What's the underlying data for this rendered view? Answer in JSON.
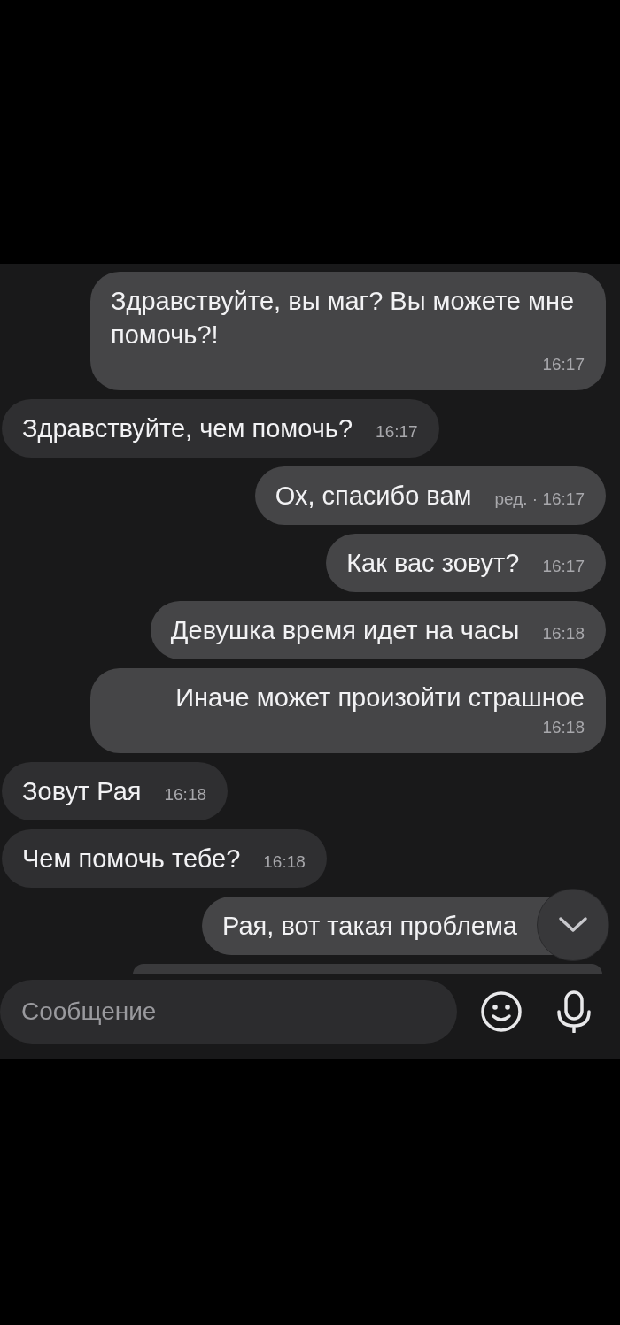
{
  "messages": [
    {
      "kind": "outgoing",
      "text": "Здравствуйте, вы маг? Вы можете мне помочь?!",
      "time": "16:17"
    },
    {
      "kind": "incoming",
      "text": "Здравствуйте, чем помочь?",
      "time": "16:17"
    },
    {
      "kind": "outgoing",
      "text": "Ох, спасибо вам",
      "time": "ред. · 16:17"
    },
    {
      "kind": "outgoing",
      "text": "Как вас зовут?",
      "time": "16:17"
    },
    {
      "kind": "outgoing",
      "text": "Девушка время идет на часы",
      "time": "16:18"
    },
    {
      "kind": "outgoing",
      "text": "Иначе может произойти страшное",
      "time": "16:18"
    },
    {
      "kind": "incoming",
      "text": "Зовут Рая",
      "time": "16:18"
    },
    {
      "kind": "incoming",
      "text": "Чем помочь тебе?",
      "time": "16:18"
    },
    {
      "kind": "outgoing",
      "text": "Рая, вот такая проблема"
    }
  ],
  "composer": {
    "placeholder": "Сообщение"
  }
}
